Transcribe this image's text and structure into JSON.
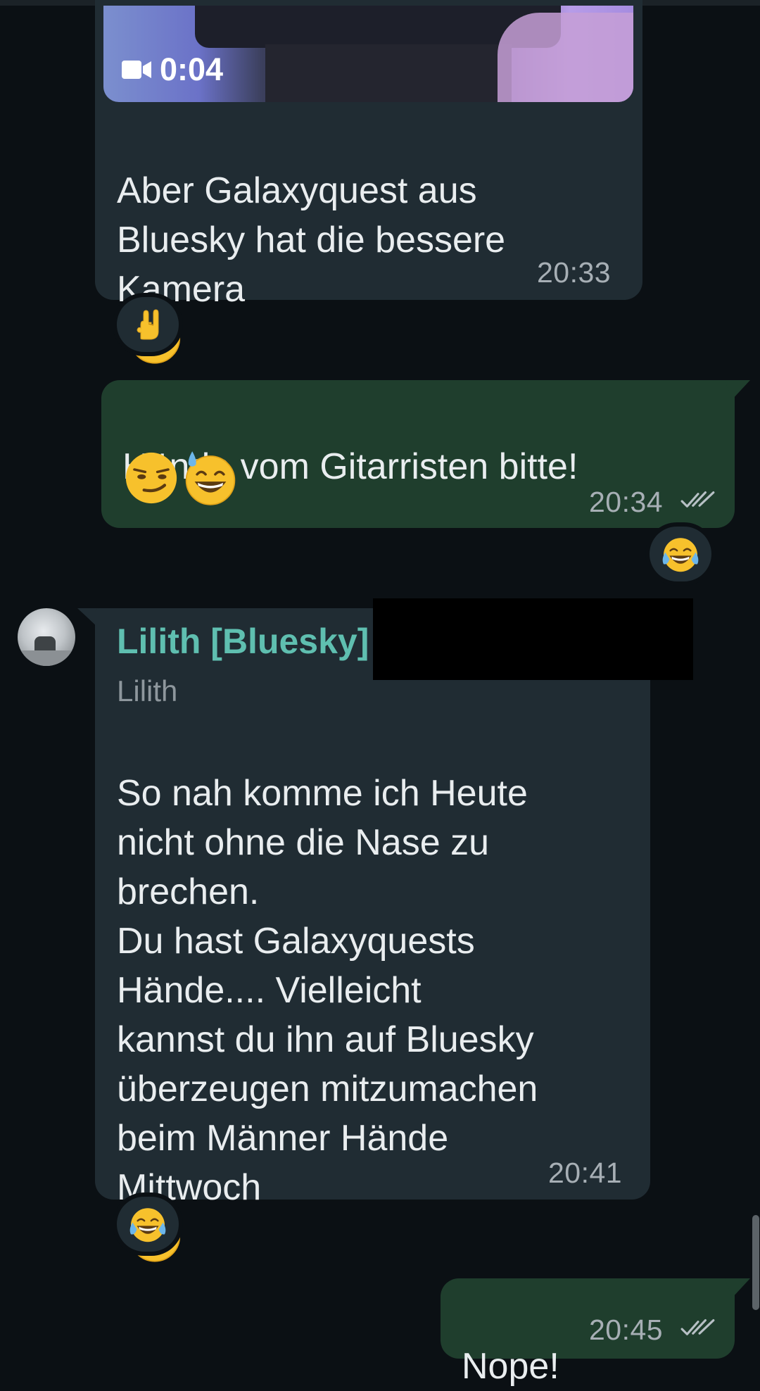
{
  "messages": {
    "m1": {
      "video_duration": "0:04",
      "text": "Aber Galaxyquest aus\nBluesky hat die bessere\nKamera",
      "time": "20:33",
      "reaction_icon": "sign-of-horns-emoji"
    },
    "m2": {
      "text": "Hände vom Gitarristen bitte!",
      "time": "20:34",
      "reaction_icon": "tears-of-joy-emoji"
    },
    "m3": {
      "sender": "Lilith [Bluesky]",
      "sender_sub": "Lilith",
      "text": "So nah komme ich Heute\nnicht ohne die Nase zu\nbrechen.\nDu hast Galaxyquests\nHände.... Vielleicht\nkannst du ihn auf Bluesky\nüberzeugen mitzumachen\nbeim Männer Hände\nMittwoch",
      "time": "20:41",
      "reaction_icon": "tears-of-joy-emoji"
    },
    "m4": {
      "text": "Nope!",
      "time": "20:45"
    }
  },
  "colors": {
    "background": "#0b1014",
    "incoming_bubble": "#202c33",
    "outgoing_bubble": "#1f3e2d",
    "sender_name": "#5fbfb0"
  }
}
